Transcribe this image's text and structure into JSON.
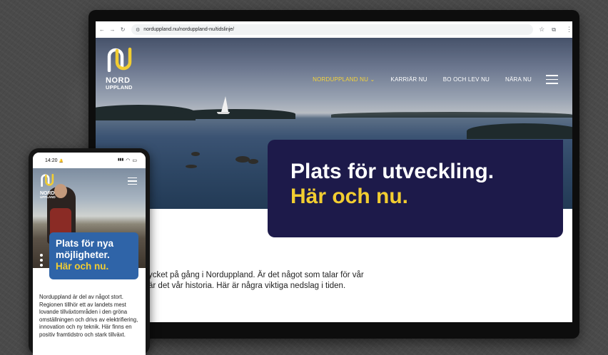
{
  "desktop": {
    "browser": {
      "url": "norduppland.nu/norduppland-nu/tidslinje/"
    },
    "logo": {
      "line1": "NORD",
      "line2": "UPPLAND"
    },
    "nav": {
      "items": [
        {
          "label": "NORDUPPLAND NU",
          "active": true
        },
        {
          "label": "KARRIÄR NU",
          "active": false
        },
        {
          "label": "BO OCH LEV NU",
          "active": false
        },
        {
          "label": "NÄRA NU",
          "active": false
        }
      ],
      "dropdown_glyph": "⌄"
    },
    "hero": {
      "headline_line1": "Plats för utveckling.",
      "headline_line2": "Här och nu."
    },
    "intro": {
      "line1": "ycket på gång i Norduppland. Är det något som talar för vår",
      "line2": "är det vår historia. Här är några viktiga nedslag i tiden."
    }
  },
  "mobile": {
    "status": {
      "time": "14:20",
      "bell": "🔔",
      "signal": "▮▮▮",
      "wifi": "◠",
      "battery": "▭"
    },
    "logo": {
      "line1": "NORD",
      "line2": "UPPLAND"
    },
    "hero": {
      "headline_line1": "Plats för nya",
      "headline_line2": "möjligheter.",
      "headline_line3": "Här och nu."
    },
    "body": "Norduppland är del av något stort. Regionen tillhör ett av landets mest lovande tillväxtområden i den gröna omställningen och drivs av elektrifiering, innovation och ny teknik. Här finns en positiv framtidstro och stark tillväxt."
  },
  "colors": {
    "brand_navy": "#1d1a4a",
    "brand_yellow": "#f2cd31",
    "mobile_blue": "#2f64a8"
  }
}
